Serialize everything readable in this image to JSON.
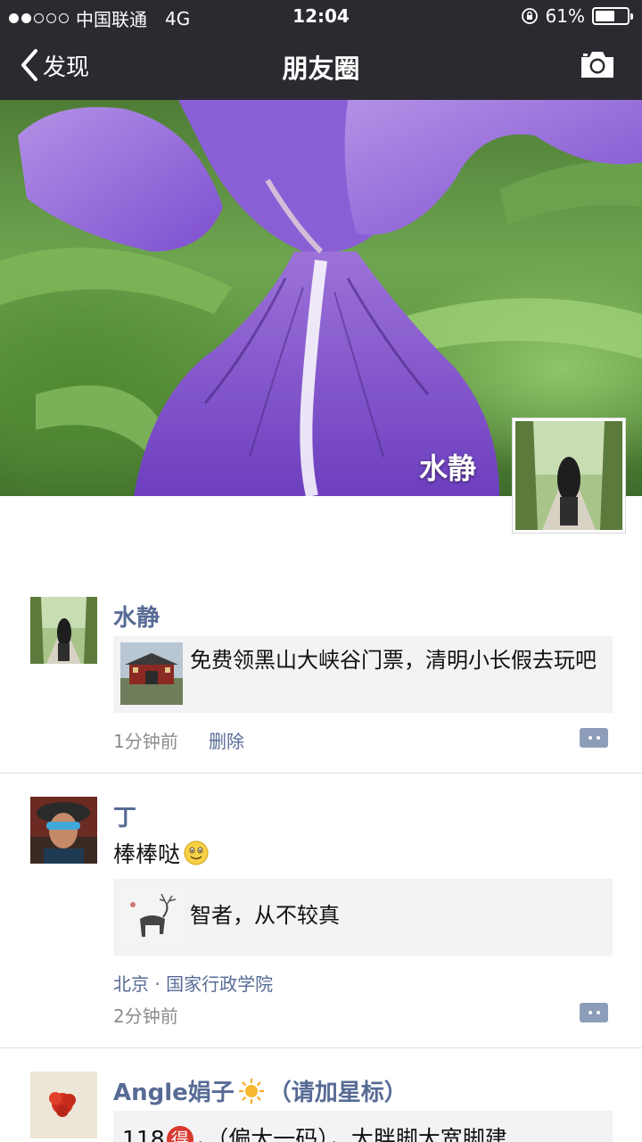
{
  "status_bar": {
    "carrier": "中国联通",
    "network": "4G",
    "time": "12:04",
    "battery": "61%",
    "battery_level": 0.61,
    "signal_bars_filled": 2,
    "signal_bars_total": 5
  },
  "nav": {
    "back_label": "发现",
    "title": "朋友圈",
    "back_icon": "chevron-left-icon",
    "camera_icon": "camera-icon"
  },
  "cover": {
    "name": "水静"
  },
  "feed": [
    {
      "name": "水静",
      "share_title": "免费领黑山大峡谷门票，清明小长假去玩吧",
      "time": "1分钟前",
      "delete_label": "删除"
    },
    {
      "name": "丁",
      "text": "棒棒哒",
      "share_title": "智者，从不较真",
      "location": "北京 · 国家行政学院",
      "time": "2分钟前"
    },
    {
      "name": "Angle娟子",
      "name_suffix": "（请加星标）",
      "text_prefix": "118",
      "badge": "得",
      "text_suffix": "，（偏大一码），大胖脚大宽脚建..."
    }
  ],
  "colors": {
    "nav_bg": "#2b2a31",
    "link": "#576b95",
    "card_bg": "#f3f3f5",
    "time_text": "#8c8c8c"
  }
}
